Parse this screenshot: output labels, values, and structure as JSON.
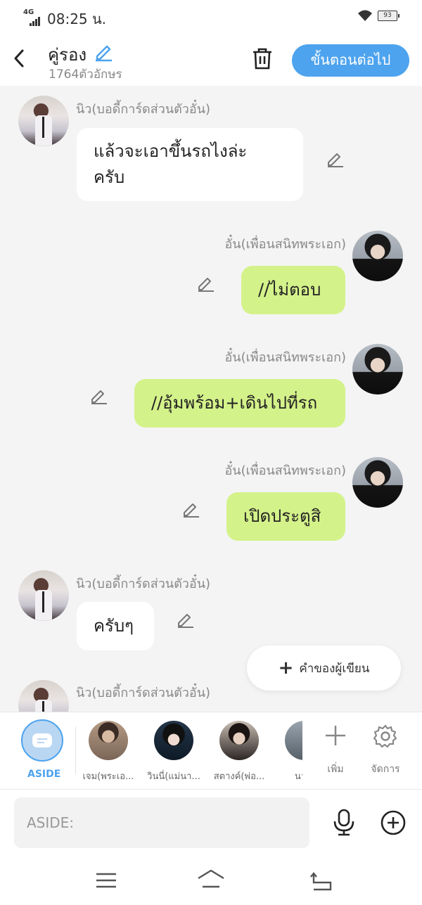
{
  "status_bar": {
    "network": "4G",
    "time": "08:25 น.",
    "battery": "93"
  },
  "header": {
    "title": "คู่รอง",
    "char_count": "1764ตัวอักษร",
    "next_button_label": "ขั้นตอนต่อไป"
  },
  "messages": [
    {
      "sender": "นิว(บอดี้การ์ดส่วนตัวอั๋น)",
      "text_line1": "แล้วจะเอาขึ้นรถไงล่ะ",
      "text_line2": "ครับ",
      "side": "left"
    },
    {
      "sender": "อั๋น(เพื่อนสนิทพระเอก)",
      "text": "//ไม่ตอบ",
      "side": "right"
    },
    {
      "sender": "อั๋น(เพื่อนสนิทพระเอก)",
      "text": "//อุ้มพร้อม+เดินไปที่รถ",
      "side": "right"
    },
    {
      "sender": "อั๋น(เพื่อนสนิทพระเอก)",
      "text": "เปิดประตูสิ",
      "side": "right"
    },
    {
      "sender": "นิว(บอดี้การ์ดส่วนตัวอั๋น)",
      "text": "ครับๆ",
      "side": "left"
    },
    {
      "sender": "นิว(บอดี้การ์ดส่วนตัวอั๋น)",
      "side": "left"
    }
  ],
  "author_note_button": "คำของผู้เขียน",
  "characters": {
    "aside_label": "ASIDE",
    "items": [
      {
        "name": "เจม(พระเอ..."
      },
      {
        "name": "วินนี่(แม่นา..."
      },
      {
        "name": "สตางค์(พ่อ..."
      },
      {
        "name": "นายเ"
      }
    ],
    "add_label": "เพิ่ม",
    "manage_label": "จัดการ"
  },
  "input": {
    "placeholder": "ASIDE:"
  },
  "colors": {
    "accent": "#4da3ee",
    "bubble_self": "#d4f28a",
    "bubble_other": "#ffffff",
    "chat_bg": "#f4f4f4"
  }
}
